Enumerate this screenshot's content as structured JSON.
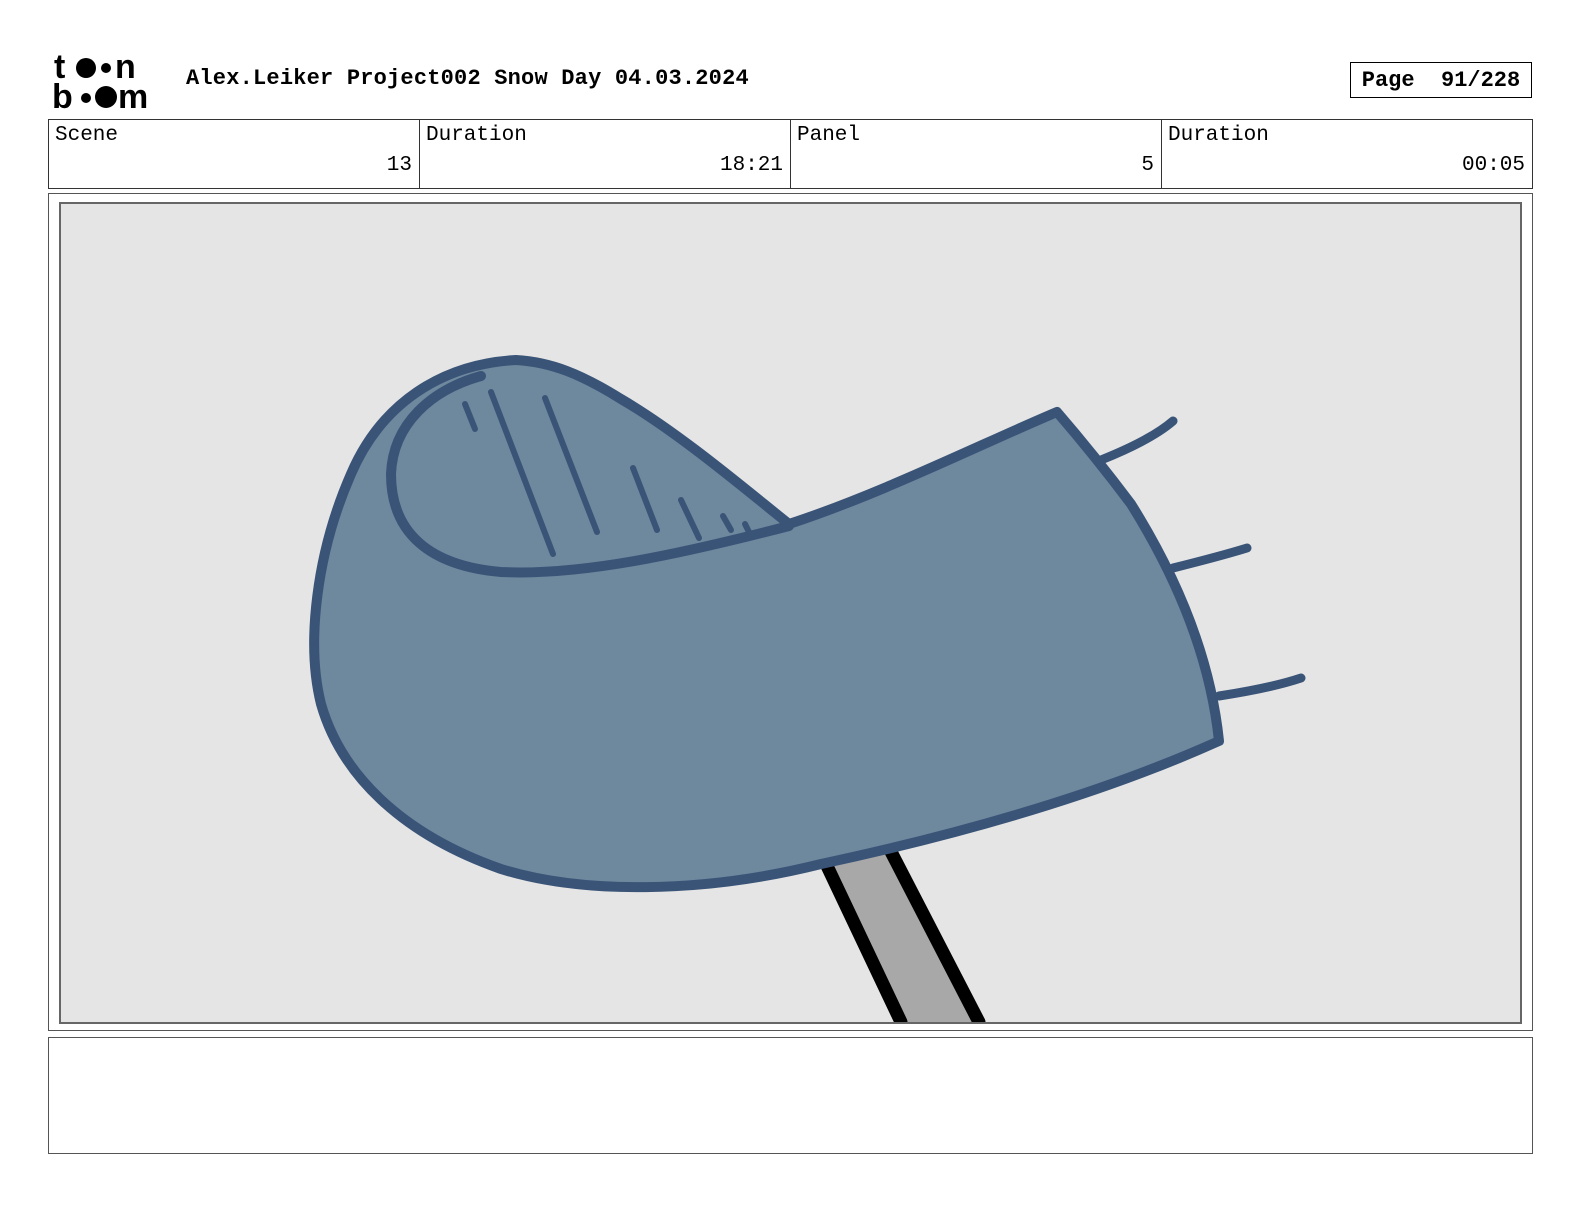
{
  "header": {
    "logo_text": "toon boom",
    "title": "Alex.Leiker Project002 Snow Day 04.03.2024",
    "page": "Page  91/228"
  },
  "info": {
    "scene_label": "Scene",
    "scene_value": "13",
    "scene_duration_label": "Duration",
    "scene_duration_value": "18:21",
    "panel_label": "Panel",
    "panel_value": "5",
    "panel_duration_label": "Duration",
    "panel_duration_value": "00:05"
  },
  "panel": {
    "colors": {
      "background": "#e5e5e5",
      "glove_fill": "#6e889e",
      "glove_outline": "#3a5478",
      "pole_fill": "#a8a8a8",
      "pole_outline": "#000000"
    }
  },
  "notes": {
    "text": ""
  }
}
